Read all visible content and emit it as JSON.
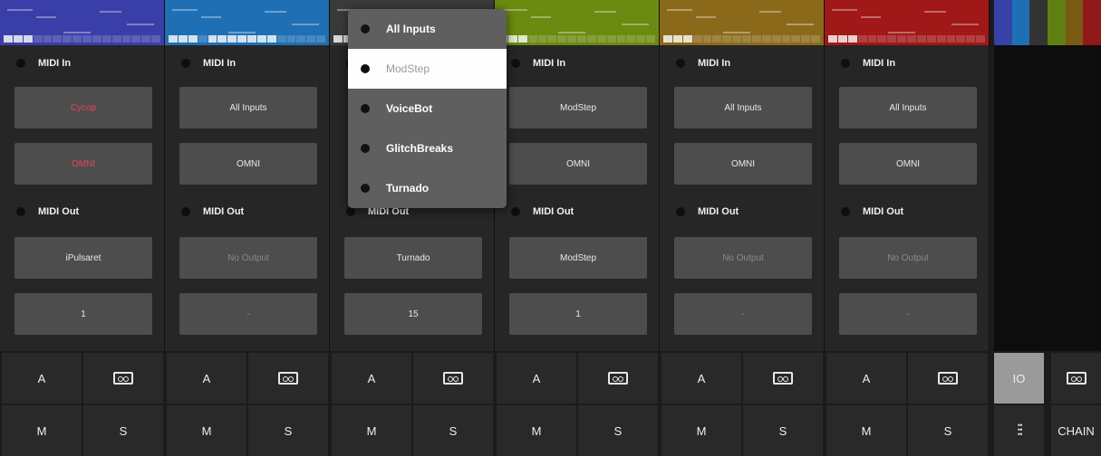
{
  "labels": {
    "midi_in": "MIDI In",
    "midi_out": "MIDI Out"
  },
  "channels": [
    {
      "color": "#3a3ea8",
      "in_source": "Cycop",
      "in_channel": "OMNI",
      "out_dest": "iPulsaret",
      "out_channel": "1",
      "source_state": "red",
      "out_state": "normal"
    },
    {
      "color": "#1f6fb4",
      "in_source": "All Inputs",
      "in_channel": "OMNI",
      "out_dest": "No Output",
      "out_channel": "-",
      "source_state": "normal",
      "out_state": "dim"
    },
    {
      "color": "#3a3a3a",
      "in_source": "",
      "in_channel": "",
      "out_dest": "Turnado",
      "out_channel": "15",
      "source_state": "normal",
      "out_state": "normal"
    },
    {
      "color": "#6a8a10",
      "in_source": "ModStep",
      "in_channel": "OMNI",
      "out_dest": "ModStep",
      "out_channel": "1",
      "source_state": "normal",
      "out_state": "normal"
    },
    {
      "color": "#8a6a1a",
      "in_source": "All Inputs",
      "in_channel": "OMNI",
      "out_dest": "No Output",
      "out_channel": "-",
      "source_state": "normal",
      "out_state": "dim"
    },
    {
      "color": "#a01818",
      "in_source": "All Inputs",
      "in_channel": "OMNI",
      "out_dest": "No Output",
      "out_channel": "-",
      "source_state": "normal",
      "out_state": "dim"
    }
  ],
  "strip": {
    "a": "A",
    "m": "M",
    "s": "S",
    "io": "IO",
    "chain": "CHAIN"
  },
  "popup": {
    "items": [
      "All Inputs",
      "ModStep",
      "VoiceBot",
      "GlitchBreaks",
      "Turnado"
    ],
    "selected": "ModStep"
  },
  "colors": {
    "popup_bg": "#5f5f5f",
    "io_active": "#9a9a9a",
    "accent_red": "#e4435a"
  }
}
